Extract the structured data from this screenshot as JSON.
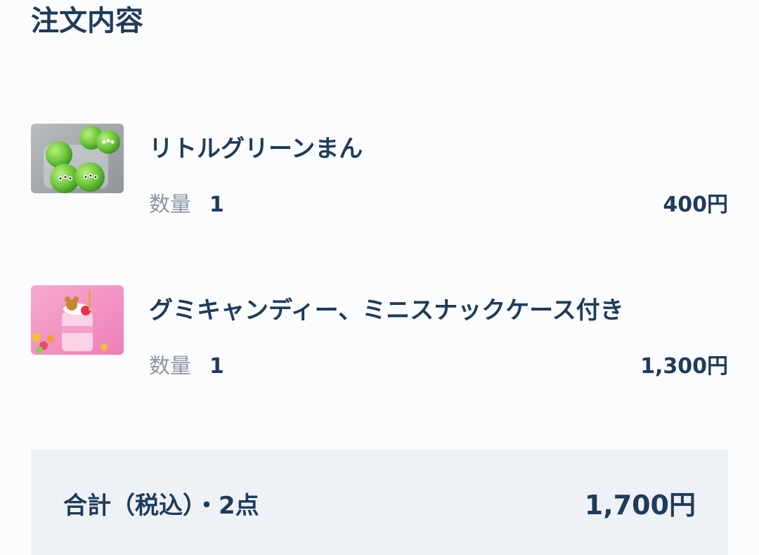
{
  "header": {
    "title": "注文内容"
  },
  "items": [
    {
      "name": "リトルグリーンまん",
      "quantity_label": "数量",
      "quantity": "1",
      "price": "400円",
      "image_icon": "green-bun-image"
    },
    {
      "name": "グミキャンディー、ミニスナックケース付き",
      "quantity_label": "数量",
      "quantity": "1",
      "price": "1,300円",
      "image_icon": "gummy-candy-image"
    }
  ],
  "summary": {
    "label": "合計（税込）・2点",
    "total": "1,700円"
  },
  "colors": {
    "text_primary": "#1f3b5a",
    "text_muted": "#8b97a5",
    "summary_bg": "#eef1f5",
    "page_bg": "#fbfcfe"
  }
}
